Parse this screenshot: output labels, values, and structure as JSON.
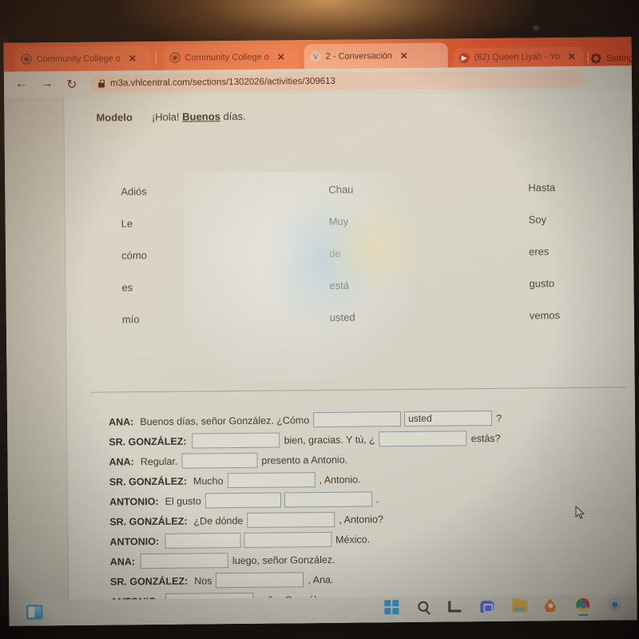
{
  "browser": {
    "tabs": [
      {
        "label": "Community College o",
        "favicon": "globe-icon",
        "close": "✕",
        "active": false
      },
      {
        "label": "Community College o",
        "favicon": "globe-icon",
        "close": "✕",
        "active": false
      },
      {
        "label": "2 - Conversación",
        "favicon": "vhl-icon",
        "close": "✕",
        "active": true
      },
      {
        "label": "(62) Queen Liyah - Yo",
        "favicon": "youtube-icon",
        "close": "✕",
        "active": false
      }
    ],
    "settings_label": "Settings",
    "nav": {
      "back": "←",
      "forward": "→",
      "reload": "↻"
    },
    "url": "m3a.vhlcentral.com/sections/1302026/activities/309613",
    "lock_icon": "lock-icon"
  },
  "page": {
    "modelo": {
      "label": "Modelo",
      "prefix": "¡Hola! ",
      "bold_word": "Buenos",
      "suffix": " días."
    },
    "word_bank": {
      "column1": [
        "Adiós",
        "Le",
        "cómo",
        "es",
        "mío"
      ],
      "column2": [
        "Chau",
        "Muy",
        "de",
        "está",
        "usted"
      ],
      "column3": [
        "Hasta",
        "Soy",
        "eres",
        "gusto",
        "vemos"
      ]
    },
    "dialogue": [
      {
        "speaker": "ANA:",
        "parts": [
          {
            "type": "text",
            "value": "Buenos días, señor González. ¿Cómo"
          },
          {
            "type": "blank",
            "value": "",
            "width": "w110"
          },
          {
            "type": "blank",
            "value": "usted",
            "width": "w110"
          },
          {
            "type": "text",
            "value": "?"
          }
        ]
      },
      {
        "speaker": "SR. GONZÁLEZ:",
        "parts": [
          {
            "type": "blank",
            "value": "",
            "width": "w110"
          },
          {
            "type": "text",
            "value": "bien, gracias. Y tú, ¿"
          },
          {
            "type": "blank",
            "value": "",
            "width": "w110"
          },
          {
            "type": "text",
            "value": "estás?"
          }
        ]
      },
      {
        "speaker": "ANA:",
        "parts": [
          {
            "type": "text",
            "value": "Regular."
          },
          {
            "type": "blank",
            "value": "",
            "width": "w95"
          },
          {
            "type": "text",
            "value": "presento a Antonio."
          }
        ]
      },
      {
        "speaker": "SR. GONZÁLEZ:",
        "parts": [
          {
            "type": "text",
            "value": "Mucho"
          },
          {
            "type": "blank",
            "value": "",
            "width": "w110"
          },
          {
            "type": "text",
            "value": ", Antonio."
          }
        ]
      },
      {
        "speaker": "ANTONIO:",
        "parts": [
          {
            "type": "text",
            "value": "El gusto"
          },
          {
            "type": "blank",
            "value": "",
            "width": "w95"
          },
          {
            "type": "blank",
            "value": "",
            "width": "w110"
          },
          {
            "type": "text",
            "value": "."
          }
        ]
      },
      {
        "speaker": "SR. GONZÁLEZ:",
        "parts": [
          {
            "type": "text",
            "value": "¿De dónde"
          },
          {
            "type": "blank",
            "value": "",
            "width": "w110"
          },
          {
            "type": "text",
            "value": ", Antonio?"
          }
        ]
      },
      {
        "speaker": "ANTONIO:",
        "parts": [
          {
            "type": "blank",
            "value": "",
            "width": "w95"
          },
          {
            "type": "blank",
            "value": "",
            "width": "w110"
          },
          {
            "type": "text",
            "value": "México."
          }
        ]
      },
      {
        "speaker": "ANA:",
        "parts": [
          {
            "type": "blank",
            "value": "",
            "width": "w110"
          },
          {
            "type": "text",
            "value": "luego, señor González."
          }
        ]
      },
      {
        "speaker": "SR. GONZÁLEZ:",
        "parts": [
          {
            "type": "text",
            "value": "Nos"
          },
          {
            "type": "blank",
            "value": "",
            "width": "w110"
          },
          {
            "type": "text",
            "value": ", Ana."
          }
        ]
      },
      {
        "speaker": "ANTONIO:",
        "parts": [
          {
            "type": "blank",
            "value": "",
            "width": "w110"
          },
          {
            "type": "text",
            "value": "señor González."
          }
        ]
      }
    ]
  },
  "taskbar": {
    "left_icon": "panel-layout-icon",
    "items": [
      "windows-start-icon",
      "search-icon",
      "task-view-icon",
      "chat-icon",
      "file-explorer-icon",
      "maps-drop-icon",
      "chrome-icon",
      "settings-cog-icon"
    ]
  },
  "colors": {
    "browser_chrome": "#e8562e",
    "page_bg": "#dbd8cc",
    "input_border": "#8e9aa0",
    "accent_blue": "#3fa9cf"
  }
}
